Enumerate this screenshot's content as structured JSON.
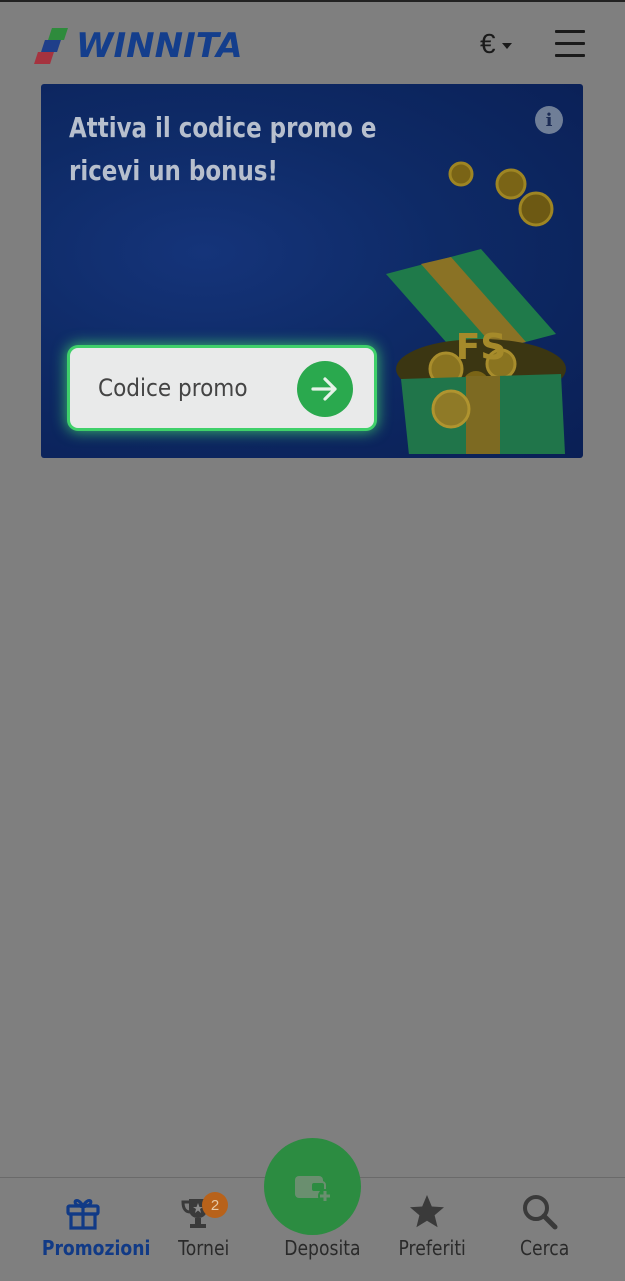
{
  "header": {
    "logo_text": "WINNITA",
    "currency_symbol": "€"
  },
  "banner": {
    "title": "Attiva il codice promo e ricevi un bonus!",
    "gift_label": "FS",
    "promo_input": {
      "placeholder": "Codice promo",
      "value": ""
    }
  },
  "bottom_nav": {
    "items": [
      {
        "label": "Promozioni",
        "icon": "gift-icon",
        "active": true
      },
      {
        "label": "Tornei",
        "icon": "trophy-icon",
        "badge": "2"
      },
      {
        "label": "Deposita",
        "icon": "wallet-plus-icon"
      },
      {
        "label": "Preferiti",
        "icon": "star-icon"
      },
      {
        "label": "Cerca",
        "icon": "search-icon"
      }
    ]
  },
  "colors": {
    "brand_blue": "#143e8c",
    "accent_green": "#2aa94e",
    "overlay_gray": "#7f7f7f",
    "badge_orange": "#b8621a"
  }
}
